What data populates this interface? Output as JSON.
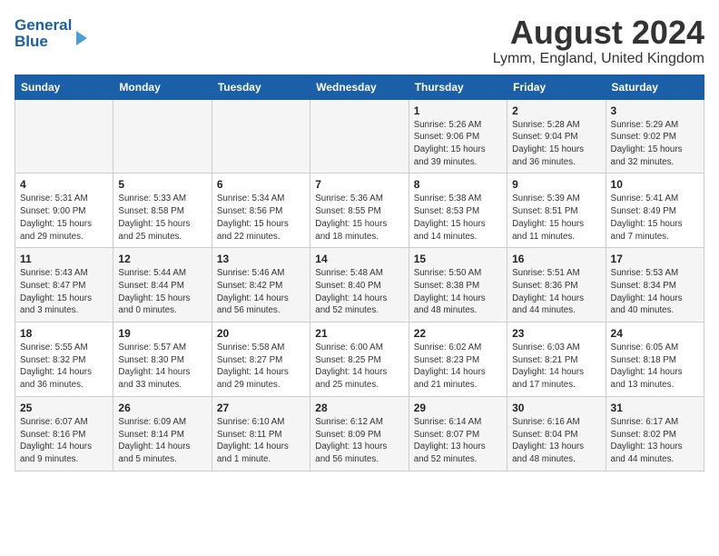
{
  "header": {
    "logo_line1": "General",
    "logo_line2": "Blue",
    "month_title": "August 2024",
    "location": "Lymm, England, United Kingdom"
  },
  "days_of_week": [
    "Sunday",
    "Monday",
    "Tuesday",
    "Wednesday",
    "Thursday",
    "Friday",
    "Saturday"
  ],
  "weeks": [
    [
      {
        "day": "",
        "info": ""
      },
      {
        "day": "",
        "info": ""
      },
      {
        "day": "",
        "info": ""
      },
      {
        "day": "",
        "info": ""
      },
      {
        "day": "1",
        "info": "Sunrise: 5:26 AM\nSunset: 9:06 PM\nDaylight: 15 hours\nand 39 minutes."
      },
      {
        "day": "2",
        "info": "Sunrise: 5:28 AM\nSunset: 9:04 PM\nDaylight: 15 hours\nand 36 minutes."
      },
      {
        "day": "3",
        "info": "Sunrise: 5:29 AM\nSunset: 9:02 PM\nDaylight: 15 hours\nand 32 minutes."
      }
    ],
    [
      {
        "day": "4",
        "info": "Sunrise: 5:31 AM\nSunset: 9:00 PM\nDaylight: 15 hours\nand 29 minutes."
      },
      {
        "day": "5",
        "info": "Sunrise: 5:33 AM\nSunset: 8:58 PM\nDaylight: 15 hours\nand 25 minutes."
      },
      {
        "day": "6",
        "info": "Sunrise: 5:34 AM\nSunset: 8:56 PM\nDaylight: 15 hours\nand 22 minutes."
      },
      {
        "day": "7",
        "info": "Sunrise: 5:36 AM\nSunset: 8:55 PM\nDaylight: 15 hours\nand 18 minutes."
      },
      {
        "day": "8",
        "info": "Sunrise: 5:38 AM\nSunset: 8:53 PM\nDaylight: 15 hours\nand 14 minutes."
      },
      {
        "day": "9",
        "info": "Sunrise: 5:39 AM\nSunset: 8:51 PM\nDaylight: 15 hours\nand 11 minutes."
      },
      {
        "day": "10",
        "info": "Sunrise: 5:41 AM\nSunset: 8:49 PM\nDaylight: 15 hours\nand 7 minutes."
      }
    ],
    [
      {
        "day": "11",
        "info": "Sunrise: 5:43 AM\nSunset: 8:47 PM\nDaylight: 15 hours\nand 3 minutes."
      },
      {
        "day": "12",
        "info": "Sunrise: 5:44 AM\nSunset: 8:44 PM\nDaylight: 15 hours\nand 0 minutes."
      },
      {
        "day": "13",
        "info": "Sunrise: 5:46 AM\nSunset: 8:42 PM\nDaylight: 14 hours\nand 56 minutes."
      },
      {
        "day": "14",
        "info": "Sunrise: 5:48 AM\nSunset: 8:40 PM\nDaylight: 14 hours\nand 52 minutes."
      },
      {
        "day": "15",
        "info": "Sunrise: 5:50 AM\nSunset: 8:38 PM\nDaylight: 14 hours\nand 48 minutes."
      },
      {
        "day": "16",
        "info": "Sunrise: 5:51 AM\nSunset: 8:36 PM\nDaylight: 14 hours\nand 44 minutes."
      },
      {
        "day": "17",
        "info": "Sunrise: 5:53 AM\nSunset: 8:34 PM\nDaylight: 14 hours\nand 40 minutes."
      }
    ],
    [
      {
        "day": "18",
        "info": "Sunrise: 5:55 AM\nSunset: 8:32 PM\nDaylight: 14 hours\nand 36 minutes."
      },
      {
        "day": "19",
        "info": "Sunrise: 5:57 AM\nSunset: 8:30 PM\nDaylight: 14 hours\nand 33 minutes."
      },
      {
        "day": "20",
        "info": "Sunrise: 5:58 AM\nSunset: 8:27 PM\nDaylight: 14 hours\nand 29 minutes."
      },
      {
        "day": "21",
        "info": "Sunrise: 6:00 AM\nSunset: 8:25 PM\nDaylight: 14 hours\nand 25 minutes."
      },
      {
        "day": "22",
        "info": "Sunrise: 6:02 AM\nSunset: 8:23 PM\nDaylight: 14 hours\nand 21 minutes."
      },
      {
        "day": "23",
        "info": "Sunrise: 6:03 AM\nSunset: 8:21 PM\nDaylight: 14 hours\nand 17 minutes."
      },
      {
        "day": "24",
        "info": "Sunrise: 6:05 AM\nSunset: 8:18 PM\nDaylight: 14 hours\nand 13 minutes."
      }
    ],
    [
      {
        "day": "25",
        "info": "Sunrise: 6:07 AM\nSunset: 8:16 PM\nDaylight: 14 hours\nand 9 minutes."
      },
      {
        "day": "26",
        "info": "Sunrise: 6:09 AM\nSunset: 8:14 PM\nDaylight: 14 hours\nand 5 minutes."
      },
      {
        "day": "27",
        "info": "Sunrise: 6:10 AM\nSunset: 8:11 PM\nDaylight: 14 hours\nand 1 minute."
      },
      {
        "day": "28",
        "info": "Sunrise: 6:12 AM\nSunset: 8:09 PM\nDaylight: 13 hours\nand 56 minutes."
      },
      {
        "day": "29",
        "info": "Sunrise: 6:14 AM\nSunset: 8:07 PM\nDaylight: 13 hours\nand 52 minutes."
      },
      {
        "day": "30",
        "info": "Sunrise: 6:16 AM\nSunset: 8:04 PM\nDaylight: 13 hours\nand 48 minutes."
      },
      {
        "day": "31",
        "info": "Sunrise: 6:17 AM\nSunset: 8:02 PM\nDaylight: 13 hours\nand 44 minutes."
      }
    ]
  ]
}
